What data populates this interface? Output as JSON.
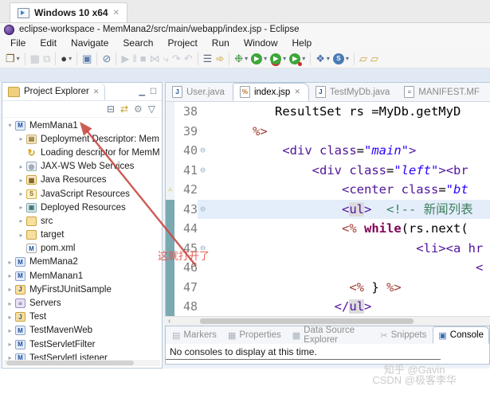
{
  "vm_tab": {
    "title": "Windows 10 x64",
    "close_glyph": "✕"
  },
  "titlebar": {
    "title": "eclipse-workspace - MemMana2/src/main/webapp/index.jsp - Eclipse"
  },
  "menu": {
    "items": [
      "File",
      "Edit",
      "Navigate",
      "Search",
      "Project",
      "Run",
      "Window",
      "Help"
    ]
  },
  "toolbar": {
    "items": [
      {
        "name": "new-wizard-icon",
        "glyph": "❐",
        "color": "#7a5c28",
        "dropdown": true
      },
      {
        "sep": true
      },
      {
        "name": "save-icon",
        "glyph": "▦",
        "color": "#c2c6cc",
        "disabled": true
      },
      {
        "name": "save-all-icon",
        "glyph": "⧉",
        "color": "#c2c6cc",
        "disabled": true
      },
      {
        "sep": true
      },
      {
        "name": "user-account-icon",
        "glyph": "●",
        "color": "#3a3a3a",
        "dropdown": true
      },
      {
        "sep": true
      },
      {
        "name": "open-console-icon",
        "glyph": "▣",
        "color": "#5a7ca8"
      },
      {
        "sep": true
      },
      {
        "name": "skip-breakpoints-icon",
        "glyph": "⊘",
        "color": "#5a7ca8"
      },
      {
        "sep": true
      },
      {
        "name": "resume-icon",
        "glyph": "▶",
        "color": "#c6cbd2",
        "disabled": true
      },
      {
        "name": "suspend-icon",
        "glyph": "‖",
        "color": "#c6cbd2",
        "disabled": true
      },
      {
        "name": "terminate-icon",
        "glyph": "■",
        "color": "#c6cbd2",
        "disabled": true
      },
      {
        "name": "disconnect-icon",
        "glyph": "⋈",
        "color": "#c6cbd2",
        "disabled": true
      },
      {
        "name": "step-into-icon",
        "glyph": "⤷",
        "color": "#c6cbd2",
        "disabled": true
      },
      {
        "name": "step-over-icon",
        "glyph": "↷",
        "color": "#c6cbd2",
        "disabled": true
      },
      {
        "name": "step-return-icon",
        "glyph": "↶",
        "color": "#c6cbd2",
        "disabled": true
      },
      {
        "sep": true
      },
      {
        "name": "show-view-menu-icon",
        "glyph": "☰",
        "color": "#5f6e80"
      },
      {
        "name": "launch-shortcut-icon",
        "glyph": "➾",
        "color": "#c29a2b"
      },
      {
        "sep": true
      },
      {
        "name": "debug-icon",
        "glyph": "❉",
        "color": "#3f8f3f",
        "dropdown": true
      },
      {
        "name": "run-icon",
        "glyph": "▶",
        "color": "#ffffff",
        "circle": "#3da639",
        "dropdown": true
      },
      {
        "name": "coverage-icon",
        "glyph": "▶",
        "color": "#ffffff",
        "circle": "#3da639",
        "underline": true,
        "dropdown": true
      },
      {
        "name": "profile-icon",
        "glyph": "▶",
        "color": "#ffffff",
        "circle": "#3da639",
        "dot": true,
        "dropdown": true
      },
      {
        "sep": true
      },
      {
        "name": "new-web-wizard-icon",
        "glyph": "❖",
        "color": "#4a6fb0",
        "dropdown": true
      },
      {
        "name": "web-service-icon",
        "glyph": "S",
        "color": "#ffffff",
        "circle": "#4a7ab5",
        "dropdown": true
      },
      {
        "sep": true
      },
      {
        "name": "open-resource-icon",
        "glyph": "▱",
        "color": "#c9a23f"
      },
      {
        "name": "open-folder-icon",
        "glyph": "▱",
        "color": "#c9a23f"
      }
    ]
  },
  "project_explorer": {
    "title": "Project Explorer",
    "close_glyph": "✕",
    "minimize_glyph": "▁",
    "maximize_glyph": "☐",
    "toolbar": [
      {
        "name": "collapse-all-icon",
        "glyph": "⊟",
        "color": "#607690"
      },
      {
        "name": "link-with-editor-icon",
        "glyph": "⇄",
        "color": "#c5a028"
      },
      {
        "name": "view-menu-gears-icon",
        "glyph": "⚙",
        "color": "#8a93a0"
      },
      {
        "name": "view-dropdown-icon",
        "glyph": "▽",
        "color": "#607690"
      }
    ],
    "tree": [
      {
        "depth": 0,
        "arrow": "expanded",
        "icon": "maven-web-project-icon",
        "glyph": "M",
        "label": "MemMana1"
      },
      {
        "depth": 1,
        "arrow": "collapsed",
        "icon": "deployment-descriptor-icon",
        "glyph": "▤",
        "label": "Deployment Descriptor: Mem"
      },
      {
        "depth": 1,
        "arrow": "none",
        "icon": "loading-descriptor-icon",
        "glyph": "↻",
        "label": "Loading descriptor for MemM"
      },
      {
        "depth": 1,
        "arrow": "collapsed",
        "icon": "jaxws-web-services-icon",
        "glyph": "◎",
        "label": "JAX-WS Web Services"
      },
      {
        "depth": 1,
        "arrow": "collapsed",
        "icon": "java-resources-icon",
        "glyph": "▦",
        "label": "Java Resources"
      },
      {
        "depth": 1,
        "arrow": "collapsed",
        "icon": "javascript-resources-icon",
        "glyph": "S",
        "label": "JavaScript Resources"
      },
      {
        "depth": 1,
        "arrow": "collapsed",
        "icon": "deployed-resources-icon",
        "glyph": "▣",
        "label": "Deployed Resources"
      },
      {
        "depth": 1,
        "arrow": "collapsed",
        "icon": "folder-icon",
        "glyph": "",
        "label": "src"
      },
      {
        "depth": 1,
        "arrow": "collapsed",
        "icon": "folder-icon",
        "glyph": "",
        "label": "target"
      },
      {
        "depth": 1,
        "arrow": "none",
        "icon": "pom-file-icon",
        "glyph": "M",
        "label": "pom.xml"
      },
      {
        "depth": 0,
        "arrow": "collapsed",
        "icon": "maven-web-project-icon",
        "glyph": "M",
        "label": "MemMana2"
      },
      {
        "depth": 0,
        "arrow": "collapsed",
        "icon": "maven-web-project-icon",
        "glyph": "M",
        "label": "MemManan1"
      },
      {
        "depth": 0,
        "arrow": "collapsed",
        "icon": "java-project-icon",
        "glyph": "J",
        "label": "MyFirstJUnitSample"
      },
      {
        "depth": 0,
        "arrow": "collapsed",
        "icon": "servers-folder-icon",
        "glyph": "≡",
        "label": "Servers"
      },
      {
        "depth": 0,
        "arrow": "collapsed",
        "icon": "java-project-icon",
        "glyph": "J",
        "label": "Test"
      },
      {
        "depth": 0,
        "arrow": "collapsed",
        "icon": "maven-web-project-icon",
        "glyph": "M",
        "label": "TestMavenWeb"
      },
      {
        "depth": 0,
        "arrow": "collapsed",
        "icon": "maven-web-project-icon",
        "glyph": "M",
        "label": "TestServletFilter"
      },
      {
        "depth": 0,
        "arrow": "collapsed",
        "icon": "maven-web-project-icon",
        "glyph": "M",
        "label": "TestServletListener"
      }
    ]
  },
  "editor": {
    "tabs": [
      {
        "label": "User.java",
        "icon": "java-file-icon",
        "glyph": "J",
        "active": false
      },
      {
        "label": "index.jsp",
        "icon": "jsp-file-icon",
        "glyph": "%",
        "active": true,
        "closable": true
      },
      {
        "label": "TestMyDb.java",
        "icon": "java-file-icon",
        "glyph": "J",
        "active": false
      },
      {
        "label": "MANIFEST.MF",
        "icon": "manifest-file-icon",
        "glyph": "≡",
        "active": false
      }
    ],
    "lines": [
      {
        "num": "38",
        "tokens": [
          [
            "         ResultSet rs =MyDb.getMyD",
            "p"
          ]
        ]
      },
      {
        "num": "39",
        "tokens": [
          [
            "      ",
            "p"
          ],
          [
            "%>",
            "j"
          ]
        ]
      },
      {
        "num": "40",
        "fold": true,
        "tokens": [
          [
            "          ",
            "p"
          ],
          [
            "<div ",
            "t"
          ],
          [
            "class",
            "t"
          ],
          [
            "=",
            "p"
          ],
          [
            "\"main\"",
            "v"
          ],
          [
            ">",
            "t"
          ]
        ]
      },
      {
        "num": "41",
        "fold": true,
        "tokens": [
          [
            "              ",
            "p"
          ],
          [
            "<div ",
            "t"
          ],
          [
            "class",
            "t"
          ],
          [
            "=",
            "p"
          ],
          [
            "\"left\"",
            "v"
          ],
          [
            ">",
            "t"
          ],
          [
            "<br",
            "t"
          ]
        ]
      },
      {
        "num": "42",
        "warn": true,
        "tokens": [
          [
            "                  ",
            "p"
          ],
          [
            "<center ",
            "t"
          ],
          [
            "class",
            "t"
          ],
          [
            "=",
            "p"
          ],
          [
            "\"bt",
            "v"
          ]
        ]
      },
      {
        "num": "43",
        "fold": true,
        "current": true,
        "ruler": true,
        "tokens": [
          [
            "                  ",
            "p"
          ],
          [
            "<",
            "t"
          ],
          [
            "ul",
            "h"
          ],
          [
            ">",
            "t"
          ],
          [
            "  ",
            "p"
          ],
          [
            "<!-- 新闻列表",
            "c"
          ]
        ]
      },
      {
        "num": "44",
        "ruler": true,
        "tokens": [
          [
            "                  ",
            "p"
          ],
          [
            "<%",
            "j"
          ],
          [
            " ",
            "p"
          ],
          [
            "while",
            "k"
          ],
          [
            "(rs.next(",
            "p"
          ]
        ]
      },
      {
        "num": "45",
        "fold": true,
        "ruler": true,
        "tokens": [
          [
            "                            ",
            "p"
          ],
          [
            "<li><a ",
            "t"
          ],
          [
            "hr",
            "t"
          ]
        ]
      },
      {
        "num": "46",
        "ruler": true,
        "tokens": [
          [
            "                                    ",
            "p"
          ],
          [
            "<",
            "t"
          ]
        ]
      },
      {
        "num": "47",
        "ruler": true,
        "tokens": [
          [
            "                   ",
            "p"
          ],
          [
            "<%",
            "j"
          ],
          [
            " } ",
            "p"
          ],
          [
            "%>",
            "j"
          ]
        ]
      },
      {
        "num": "48",
        "ruler": true,
        "tokens": [
          [
            "                 ",
            "p"
          ],
          [
            "</",
            "t"
          ],
          [
            "ul",
            "h"
          ],
          [
            ">",
            "t"
          ]
        ]
      }
    ]
  },
  "console_panel": {
    "tabs": [
      {
        "label": "Markers",
        "icon": "markers-icon",
        "glyph": "▤",
        "active": false
      },
      {
        "label": "Properties",
        "icon": "properties-icon",
        "glyph": "▦",
        "active": false
      },
      {
        "label": "Data Source Explorer",
        "icon": "data-source-explorer-icon",
        "glyph": "▩",
        "active": false
      },
      {
        "label": "Snippets",
        "icon": "snippets-icon",
        "glyph": "✂",
        "active": false
      },
      {
        "label": "Console",
        "icon": "console-icon",
        "glyph": "▣",
        "active": true
      }
    ],
    "message": "No consoles to display at this time."
  },
  "annotation": {
    "text": "这就打开了"
  },
  "watermark": {
    "line1": "知乎 @Gavin",
    "line2": "CSDN @极客李华"
  },
  "glyphs": {
    "fold": "⊖",
    "warning": "⚠",
    "close": "✕",
    "dropdown": "▾",
    "collapsed": "▸",
    "expanded": "▾",
    "scroll_left": "‹"
  },
  "colors": {
    "tag": "#50149b",
    "val": "#2a00ff",
    "kw": "#7f0055",
    "jsp": "#a43d32",
    "com": "#3f7f5f",
    "num": "#7d7d7d",
    "cur": "#e4eefa",
    "occ": "#dcdcdc",
    "teal": "#7ba9b2",
    "warn": "#e0a90f",
    "red": "#c94a42",
    "wm": "#cbcbcb"
  }
}
